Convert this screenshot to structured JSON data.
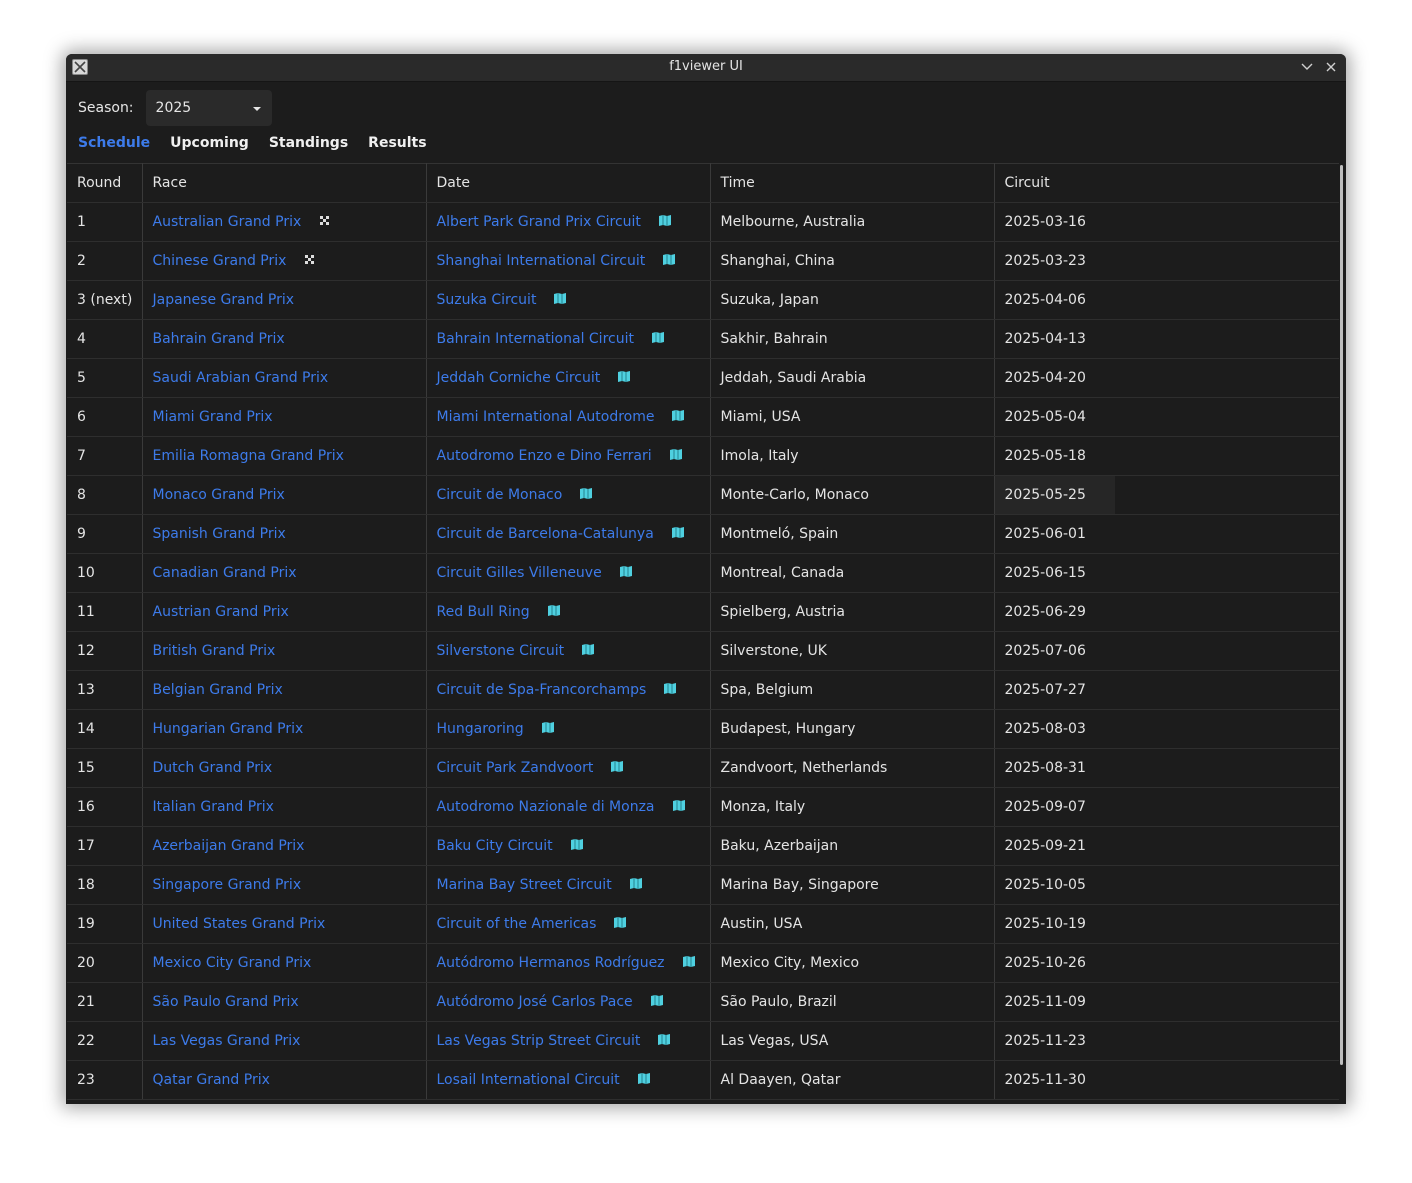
{
  "window": {
    "title": "f1viewer UI"
  },
  "season": {
    "label": "Season:",
    "value": "2025"
  },
  "tabs": [
    {
      "label": "Schedule",
      "active": true
    },
    {
      "label": "Upcoming",
      "active": false
    },
    {
      "label": "Standings",
      "active": false
    },
    {
      "label": "Results",
      "active": false
    }
  ],
  "table": {
    "headers": [
      "Round",
      "Race",
      "Date",
      "Time",
      "Circuit"
    ],
    "rows": [
      {
        "round": "1",
        "race": "Australian Grand Prix",
        "race_icon": "chequered-flag-icon",
        "circuit": "Albert Park Grand Prix Circuit",
        "location": "Melbourne, Australia",
        "date": "2025-03-16"
      },
      {
        "round": "2",
        "race": "Chinese Grand Prix",
        "race_icon": "chequered-flag-icon",
        "circuit": "Shanghai International Circuit",
        "location": "Shanghai, China",
        "date": "2025-03-23"
      },
      {
        "round": "3 (next)",
        "race": "Japanese Grand Prix",
        "race_icon": "",
        "circuit": "Suzuka Circuit",
        "location": "Suzuka, Japan",
        "date": "2025-04-06"
      },
      {
        "round": "4",
        "race": "Bahrain Grand Prix",
        "race_icon": "",
        "circuit": "Bahrain International Circuit",
        "location": "Sakhir, Bahrain",
        "date": "2025-04-13"
      },
      {
        "round": "5",
        "race": "Saudi Arabian Grand Prix",
        "race_icon": "",
        "circuit": "Jeddah Corniche Circuit",
        "location": "Jeddah, Saudi Arabia",
        "date": "2025-04-20"
      },
      {
        "round": "6",
        "race": "Miami Grand Prix",
        "race_icon": "",
        "circuit": "Miami International Autodrome",
        "location": "Miami, USA",
        "date": "2025-05-04"
      },
      {
        "round": "7",
        "race": "Emilia Romagna Grand Prix",
        "race_icon": "",
        "circuit": "Autodromo Enzo e Dino Ferrari",
        "location": "Imola, Italy",
        "date": "2025-05-18"
      },
      {
        "round": "8",
        "race": "Monaco Grand Prix",
        "race_icon": "",
        "circuit": "Circuit de Monaco",
        "location": "Monte-Carlo, Monaco",
        "date": "2025-05-25",
        "highlight": true
      },
      {
        "round": "9",
        "race": "Spanish Grand Prix",
        "race_icon": "",
        "circuit": "Circuit de Barcelona-Catalunya",
        "location": "Montmeló, Spain",
        "date": "2025-06-01"
      },
      {
        "round": "10",
        "race": "Canadian Grand Prix",
        "race_icon": "",
        "circuit": "Circuit Gilles Villeneuve",
        "location": "Montreal, Canada",
        "date": "2025-06-15"
      },
      {
        "round": "11",
        "race": "Austrian Grand Prix",
        "race_icon": "",
        "circuit": "Red Bull Ring",
        "location": "Spielberg, Austria",
        "date": "2025-06-29"
      },
      {
        "round": "12",
        "race": "British Grand Prix",
        "race_icon": "",
        "circuit": "Silverstone Circuit",
        "location": "Silverstone, UK",
        "date": "2025-07-06"
      },
      {
        "round": "13",
        "race": "Belgian Grand Prix",
        "race_icon": "",
        "circuit": "Circuit de Spa-Francorchamps",
        "location": "Spa, Belgium",
        "date": "2025-07-27"
      },
      {
        "round": "14",
        "race": "Hungarian Grand Prix",
        "race_icon": "",
        "circuit": "Hungaroring",
        "location": "Budapest, Hungary",
        "date": "2025-08-03"
      },
      {
        "round": "15",
        "race": "Dutch Grand Prix",
        "race_icon": "",
        "circuit": "Circuit Park Zandvoort",
        "location": "Zandvoort, Netherlands",
        "date": "2025-08-31"
      },
      {
        "round": "16",
        "race": "Italian Grand Prix",
        "race_icon": "",
        "circuit": "Autodromo Nazionale di Monza",
        "location": "Monza, Italy",
        "date": "2025-09-07"
      },
      {
        "round": "17",
        "race": "Azerbaijan Grand Prix",
        "race_icon": "",
        "circuit": "Baku City Circuit",
        "location": "Baku, Azerbaijan",
        "date": "2025-09-21"
      },
      {
        "round": "18",
        "race": "Singapore Grand Prix",
        "race_icon": "",
        "circuit": "Marina Bay Street Circuit",
        "location": "Marina Bay, Singapore",
        "date": "2025-10-05"
      },
      {
        "round": "19",
        "race": "United States Grand Prix",
        "race_icon": "",
        "circuit": "Circuit of the Americas",
        "location": "Austin, USA",
        "date": "2025-10-19"
      },
      {
        "round": "20",
        "race": "Mexico City Grand Prix",
        "race_icon": "",
        "circuit": "Autódromo Hermanos Rodríguez",
        "location": "Mexico City, Mexico",
        "date": "2025-10-26"
      },
      {
        "round": "21",
        "race": "São Paulo Grand Prix",
        "race_icon": "",
        "circuit": "Autódromo José Carlos Pace",
        "location": "São Paulo, Brazil",
        "date": "2025-11-09"
      },
      {
        "round": "22",
        "race": "Las Vegas Grand Prix",
        "race_icon": "",
        "circuit": "Las Vegas Strip Street Circuit",
        "location": "Las Vegas, USA",
        "date": "2025-11-23"
      },
      {
        "round": "23",
        "race": "Qatar Grand Prix",
        "race_icon": "",
        "circuit": "Losail International Circuit",
        "location": "Al Daayen, Qatar",
        "date": "2025-11-30"
      }
    ]
  },
  "colors": {
    "link": "#3d7bea",
    "background": "#1c1c1c",
    "map_icon": "#4fd0e0"
  }
}
